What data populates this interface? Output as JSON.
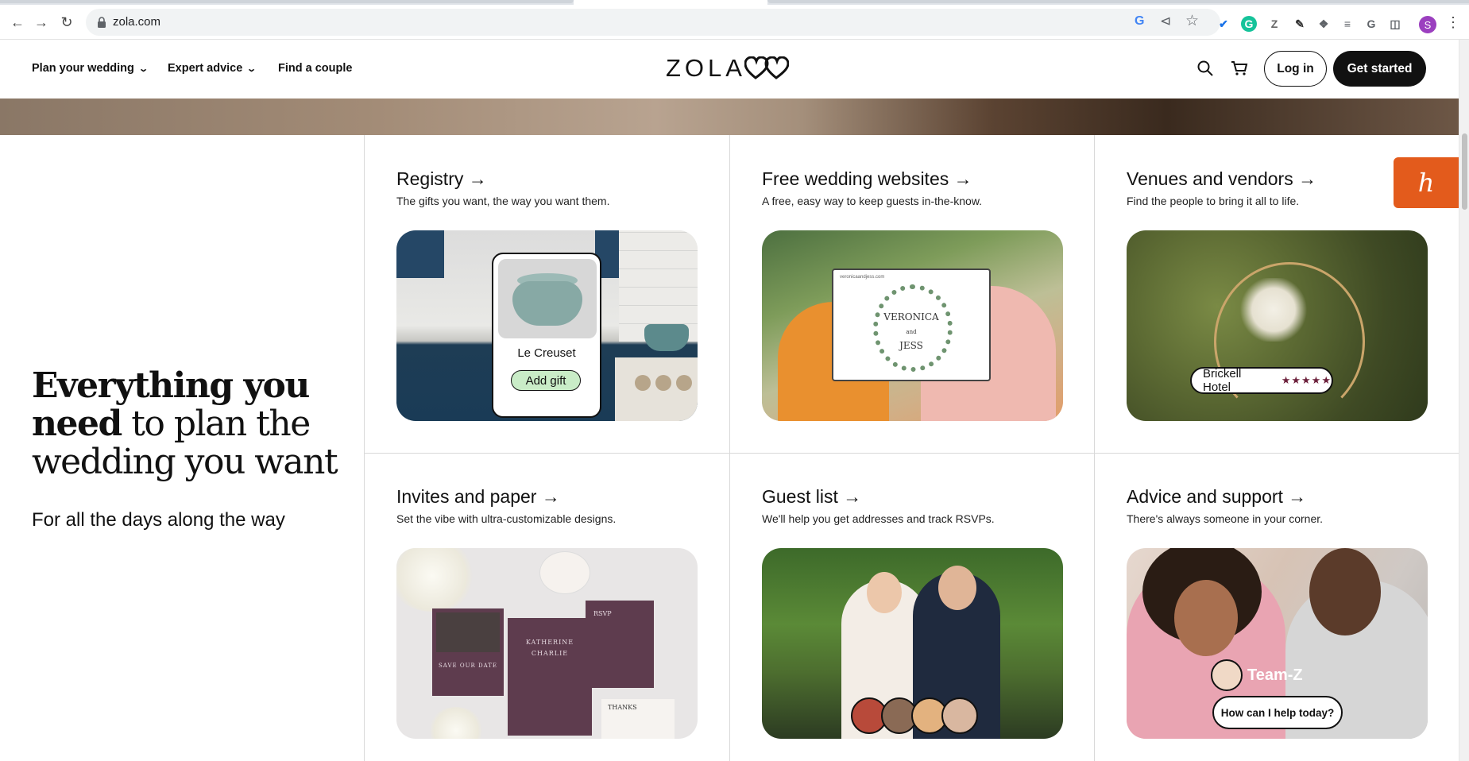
{
  "browser": {
    "url": "zola.com",
    "profile_initial": "S"
  },
  "header": {
    "nav": [
      {
        "label": "Plan your wedding"
      },
      {
        "label": "Expert advice"
      },
      {
        "label": "Find a couple"
      }
    ],
    "logo_text": "ZOLA",
    "login_label": "Log in",
    "get_started_label": "Get started"
  },
  "intro": {
    "headline_bold_1": "Everything you",
    "headline_bold_2": "need",
    "headline_rest_1": " to plan the",
    "headline_rest_2": "wedding you want",
    "subhead": "For all the days along the way"
  },
  "cards": [
    {
      "title": "Registry",
      "desc": "The gifts you want, the way you want them."
    },
    {
      "title": "Free wedding websites",
      "desc": "A free, easy way to keep guests in-the-know."
    },
    {
      "title": "Venues and vendors",
      "desc": "Find the people to bring it all to life."
    },
    {
      "title": "Invites and paper",
      "desc": "Set the vibe with ultra-customizable designs."
    },
    {
      "title": "Guest list",
      "desc": "We'll help you get addresses and track RSVPs."
    },
    {
      "title": "Advice and support",
      "desc": "There's always someone in your corner."
    }
  ],
  "arrow": "→",
  "registry_image": {
    "brand": "Le Creuset",
    "button": "Add gift"
  },
  "website_image": {
    "url": "veronicaandjess.com",
    "name1": "VERONICA",
    "and": "and",
    "name2": "JESS"
  },
  "venue_image": {
    "name": "Brickell Hotel",
    "stars": "★★★★★"
  },
  "invites_image": {
    "std": "SAVE OUR DATE",
    "names": [
      "KATHERINE",
      "CHARLIE"
    ],
    "rsvp": "RSVP",
    "thanks": "THANKS"
  },
  "advice_image": {
    "team": "Team-Z",
    "bubble": "How can I help today?"
  },
  "floating_badge": "h",
  "colors": {
    "accent": "#111111",
    "badge": "#e35b1c",
    "invite_plum": "#5e3c4e",
    "add_gift_green": "#c9ecc7"
  }
}
